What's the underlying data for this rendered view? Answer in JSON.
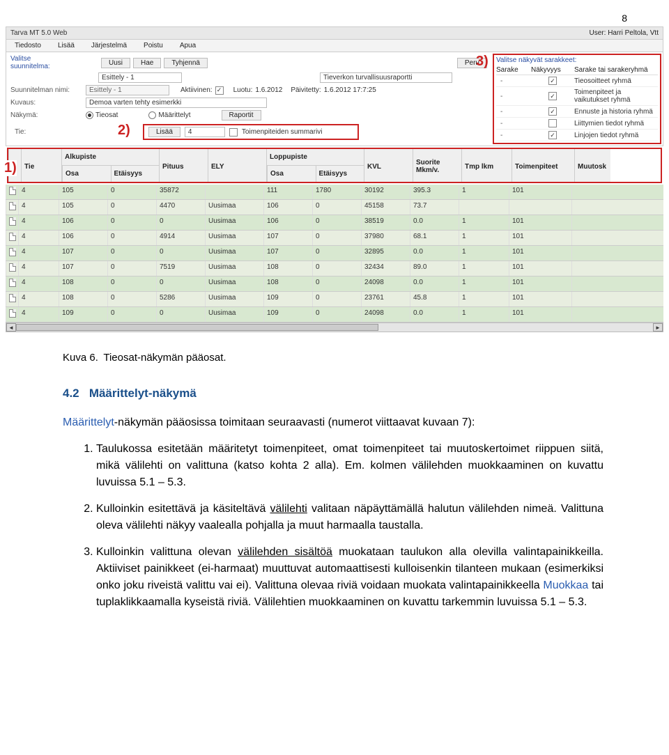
{
  "page_number": "8",
  "screenshot": {
    "title": "Tarva MT 5.0 Web",
    "user_label": "User:",
    "user_value": "Harri Peltola, Vtt",
    "menu": [
      "Tiedosto",
      "Lisää",
      "Järjestelmä",
      "Poistu",
      "Apua"
    ],
    "labels": {
      "valitse": "Valitse\nsuunnitelma:",
      "suunnitelman_nimi": "Suunnitelman nimi:",
      "kuvaus": "Kuvaus:",
      "nakyma": "Näkymä:",
      "tie": "Tie:"
    },
    "buttons": {
      "uusi": "Uusi",
      "hae": "Hae",
      "tyhjenna": "Tyhjennä",
      "peru": "Peru",
      "lisaa": "Lisää",
      "raportit": "Raportit"
    },
    "selects": {
      "plan_pick": "Esittely - 1",
      "report_pick": "Tieverkon turvallisuusraportti",
      "tie_num": "4"
    },
    "inputs": {
      "plan_name": "Esittely - 1",
      "kuvaus": "Demoa varten tehty esimerkki"
    },
    "flags": {
      "aktiivinen_lbl": "Aktiivinen:",
      "luotu_lbl": "Luotu:",
      "luotu_val": "1.6.2012",
      "paivitetty_lbl": "Päivitetty:",
      "paivitetty_val": "1.6.2012 17:7:25",
      "summarivi": "Toimenpiteiden summarivi"
    },
    "radios": {
      "tieosat": "Tieosat",
      "maarittelyt": "Määrittelyt"
    },
    "right_panel": {
      "title": "Valitse näkyvät sarakkeet:",
      "head": {
        "sarake": "Sarake",
        "nakyvyys": "Näkyvyys",
        "group": "Sarake tai sarakeryhmä"
      },
      "rows": [
        {
          "s": "-",
          "chk": true,
          "g": "Tieosoitteet ryhmä"
        },
        {
          "s": "-",
          "chk": true,
          "g": "Toimenpiteet ja vaikutukset ryhmä"
        },
        {
          "s": "-",
          "chk": true,
          "g": "Ennuste ja historia ryhmä"
        },
        {
          "s": "-",
          "chk": false,
          "g": "Liittymien tiedot ryhmä"
        },
        {
          "s": "-",
          "chk": true,
          "g": "Linjojen tiedot ryhmä"
        }
      ]
    },
    "markers": {
      "m1": "1)",
      "m2": "2)",
      "m3": "3)"
    },
    "table": {
      "headers": {
        "tie": "Tie",
        "alkupiste": "Alkupiste",
        "pituus": "Pituus",
        "ely": "ELY",
        "loppupiste": "Loppupiste",
        "kvl": "KVL",
        "suorite": "Suorite Mkm/v.",
        "tmplkm": "Tmp lkm",
        "toimenpiteet": "Toimenpiteet",
        "muutos": "Muutosk",
        "osa": "Osa",
        "etaisyys": "Etäisyys"
      },
      "rows": [
        {
          "tie": "4",
          "a_osa": "105",
          "a_eta": "0",
          "pituus": "35872",
          "ely": "",
          "l_osa": "111",
          "l_eta": "1780",
          "kvl": "30192",
          "suorite": "395.3",
          "tmp": "1",
          "toim": "101"
        },
        {
          "tie": "4",
          "a_osa": "105",
          "a_eta": "0",
          "pituus": "4470",
          "ely": "Uusimaa",
          "l_osa": "106",
          "l_eta": "0",
          "kvl": "45158",
          "suorite": "73.7",
          "tmp": "",
          "toim": ""
        },
        {
          "tie": "4",
          "a_osa": "106",
          "a_eta": "0",
          "pituus": "0",
          "ely": "Uusimaa",
          "l_osa": "106",
          "l_eta": "0",
          "kvl": "38519",
          "suorite": "0.0",
          "tmp": "1",
          "toim": "101"
        },
        {
          "tie": "4",
          "a_osa": "106",
          "a_eta": "0",
          "pituus": "4914",
          "ely": "Uusimaa",
          "l_osa": "107",
          "l_eta": "0",
          "kvl": "37980",
          "suorite": "68.1",
          "tmp": "1",
          "toim": "101"
        },
        {
          "tie": "4",
          "a_osa": "107",
          "a_eta": "0",
          "pituus": "0",
          "ely": "Uusimaa",
          "l_osa": "107",
          "l_eta": "0",
          "kvl": "32895",
          "suorite": "0.0",
          "tmp": "1",
          "toim": "101"
        },
        {
          "tie": "4",
          "a_osa": "107",
          "a_eta": "0",
          "pituus": "7519",
          "ely": "Uusimaa",
          "l_osa": "108",
          "l_eta": "0",
          "kvl": "32434",
          "suorite": "89.0",
          "tmp": "1",
          "toim": "101"
        },
        {
          "tie": "4",
          "a_osa": "108",
          "a_eta": "0",
          "pituus": "0",
          "ely": "Uusimaa",
          "l_osa": "108",
          "l_eta": "0",
          "kvl": "24098",
          "suorite": "0.0",
          "tmp": "1",
          "toim": "101"
        },
        {
          "tie": "4",
          "a_osa": "108",
          "a_eta": "0",
          "pituus": "5286",
          "ely": "Uusimaa",
          "l_osa": "109",
          "l_eta": "0",
          "kvl": "23761",
          "suorite": "45.8",
          "tmp": "1",
          "toim": "101"
        },
        {
          "tie": "4",
          "a_osa": "109",
          "a_eta": "0",
          "pituus": "0",
          "ely": "Uusimaa",
          "l_osa": "109",
          "l_eta": "0",
          "kvl": "24098",
          "suorite": "0.0",
          "tmp": "1",
          "toim": "101"
        }
      ]
    }
  },
  "text": {
    "caption": "Kuva 6. Tieosat-näkymän pääosat.",
    "heading_num": "4.2",
    "heading": "Määrittelyt-näkymä",
    "lead_blue": "Määrittelyt",
    "lead_rest": "-näkymän pääosissa toimitaan seuraavasti (numerot viittaavat kuvaan 7):",
    "li1": "Taulukossa esitetään määritetyt toimenpiteet, omat toimenpiteet tai muutoskertoimet riippuen siitä, mikä välilehti on valittuna (katso kohta 2 alla). Em. kolmen välilehden muokkaaminen on kuvattu luvuissa 5.1 – 5.3.",
    "li2a": "Kulloinkin esitettävä ja käsiteltävä ",
    "li2u": "välilehti",
    "li2b": " valitaan näpäyttämällä halutun välilehden nimeä. Valittuna oleva välilehti näkyy vaalealla pohjalla ja muut harmaalla taustalla.",
    "li3a": "Kulloinkin valittuna olevan ",
    "li3u": "välilehden sisältöä",
    "li3b": " muokataan taulukon alla olevilla valintapainikkeilla. Aktiiviset painikkeet (ei-harmaat) muuttuvat automaattisesti kulloisenkin tilanteen mukaan (esimerkiksi onko joku riveistä valittu vai ei). Valittuna olevaa riviä voidaan muokata valintapainikkeella ",
    "li3_blue": "Muokkaa",
    "li3c": " tai tuplaklikkaamalla kyseistä riviä. Välilehtien muokkaaminen on kuvattu tarkemmin luvuissa 5.1 – 5.3."
  }
}
